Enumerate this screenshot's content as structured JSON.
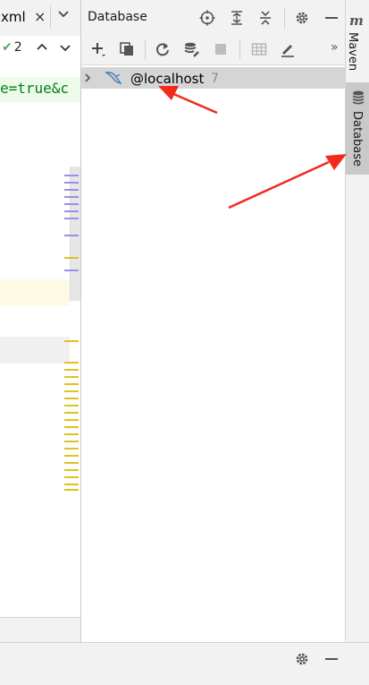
{
  "editor": {
    "tab_name": "xml",
    "tab_close": "×",
    "inspection_count": "2",
    "inspection_check": "✔",
    "code_fragment": "e=true&c"
  },
  "database": {
    "title": "Database",
    "header_icons": [
      "crosshair-icon",
      "expand-all-icon",
      "collapse-all-icon",
      "gear-icon",
      "minimize-icon"
    ],
    "toolbar_icons": [
      "add-icon",
      "copy-icon",
      "refresh-icon",
      "schema-settings-icon",
      "stop-icon",
      "table-icon",
      "edit-icon"
    ],
    "toolbar_more": "»",
    "tree": [
      {
        "label": "@localhost",
        "count": "7",
        "icon": "mysql-dolphin-icon",
        "expanded": false
      }
    ]
  },
  "right_strip": {
    "maven_icon_text": "m",
    "maven_label": "Maven",
    "database_label": "Database"
  },
  "bottom_bar": {
    "icons": [
      "gear-icon",
      "minimize-icon"
    ]
  },
  "colors": {
    "annotation_arrow": "#f22a1a",
    "selected_row": "#d5d5d5",
    "code_string": "#067d17"
  }
}
